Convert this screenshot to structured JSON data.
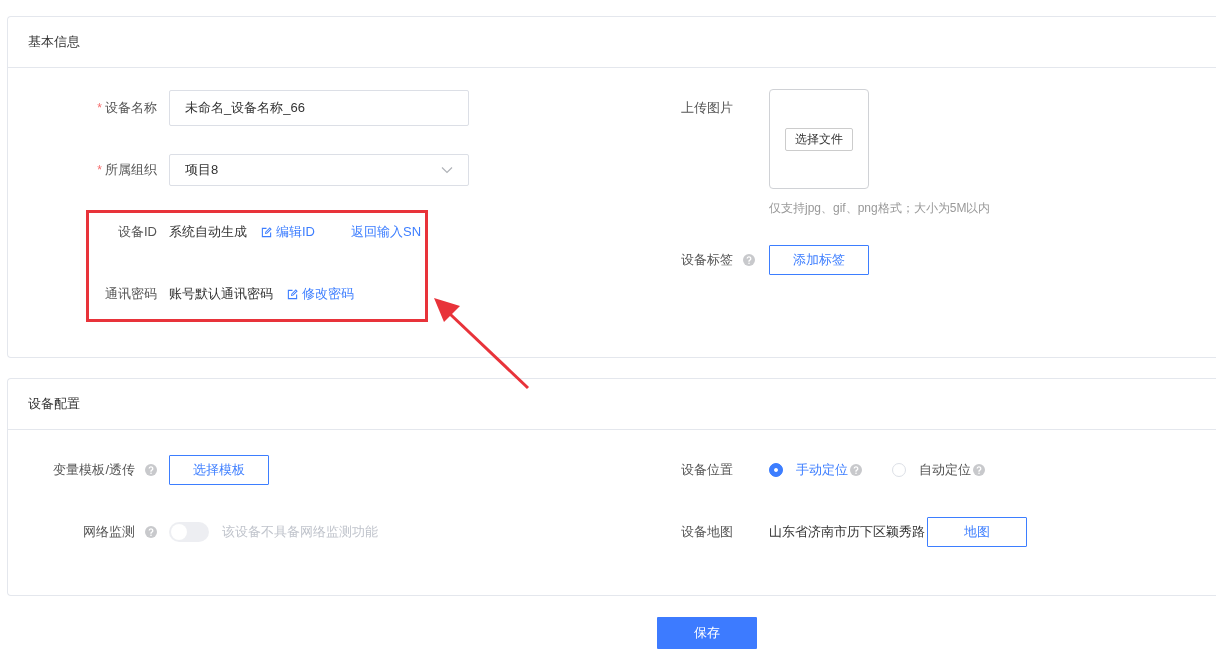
{
  "sections": [
    {
      "title": "基本信息",
      "left": [
        {
          "kind": "input",
          "label": "设备名称",
          "required_mark": "*",
          "help": false,
          "value": "未命名_设备名称_66"
        },
        {
          "kind": "select",
          "label": "所属组织",
          "required_mark": "*",
          "help": false,
          "value": "项目8"
        },
        {
          "kind": "text-links",
          "label": "设备ID",
          "help": false,
          "text": "系统自动生成",
          "links": [
            {
              "text": "编辑ID",
              "icon": true
            },
            {
              "text": "返回输入SN",
              "icon": false
            }
          ]
        },
        {
          "kind": "text-links",
          "label": "通讯密码",
          "help": false,
          "text": "账号默认通讯密码",
          "links": [
            {
              "text": "修改密码",
              "icon": true
            }
          ]
        }
      ],
      "right": [
        {
          "kind": "upload",
          "label": "上传图片",
          "help": false,
          "button": "选择文件",
          "hint": "仅支持jpg、gif、png格式；大小为5M以内"
        },
        {
          "kind": "button",
          "label": "设备标签",
          "help": true,
          "button": "添加标签"
        }
      ]
    },
    {
      "title": "设备配置",
      "left": [
        {
          "kind": "button",
          "label": "变量模板/透传",
          "help": true,
          "button": "选择模板"
        },
        {
          "kind": "switch",
          "label": "网络监测",
          "help": true,
          "on": false,
          "disabled": true,
          "text": "该设备不具备网络监测功能"
        }
      ],
      "right": [
        {
          "kind": "radio",
          "label": "设备位置",
          "help": false,
          "options": [
            {
              "label": "手动定位",
              "selected": true,
              "help": true
            },
            {
              "label": "自动定位",
              "selected": false,
              "help": true
            }
          ]
        },
        {
          "kind": "address",
          "label": "设备地图",
          "help": false,
          "text": "山东省济南市历下区颖秀路",
          "button": "地图"
        }
      ]
    }
  ],
  "save_button": "保存"
}
